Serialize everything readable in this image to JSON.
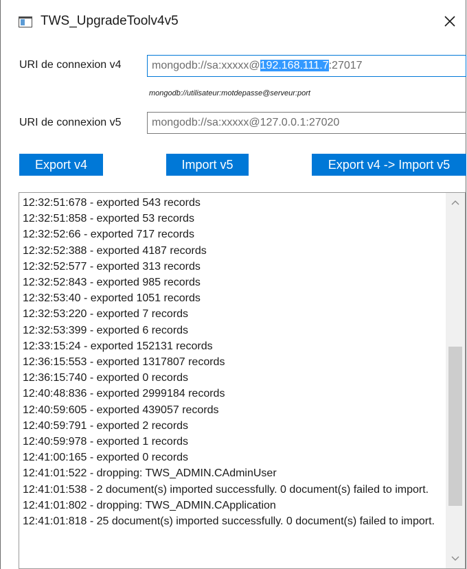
{
  "window": {
    "title": "TWS_UpgradeToolv4v5"
  },
  "form": {
    "v4_label": "URI de connexion v4",
    "v4_value_before": "mongodb://sa:xxxxx@",
    "v4_value_selected": "192.168.111.7",
    "v4_value_after": ":27017",
    "hint": "mongodb://utilisateur:motdepasse@serveur:port",
    "v5_label": "URI de connexion v5",
    "v5_value": "mongodb://sa:xxxxx@127.0.0.1:27020"
  },
  "buttons": {
    "export_v4": "Export v4",
    "import_v5": "Import v5",
    "export_import": "Export v4 -> Import v5"
  },
  "log": {
    "lines": [
      "12:32:51:678 - exported 543 records",
      "12:32:51:858 - exported 53 records",
      "12:32:52:66 - exported 717 records",
      "12:32:52:388 - exported 4187 records",
      "12:32:52:577 - exported 313 records",
      "12:32:52:843 - exported 985 records",
      "12:32:53:40 - exported 1051 records",
      "12:32:53:220 - exported 7 records",
      "12:32:53:399 - exported 6 records",
      "12:33:15:24 - exported 152131 records",
      "12:36:15:553 - exported 1317807 records",
      "12:36:15:740 - exported 0 records",
      "12:40:48:836 - exported 2999184 records",
      "12:40:59:605 - exported 439057 records",
      "12:40:59:791 - exported 2 records",
      "12:40:59:978 - exported 1 records",
      "12:41:00:165 - exported 0 records",
      "12:41:01:522 - dropping: TWS_ADMIN.CAdminUser",
      "12:41:01:538 - 2 document(s) imported successfully. 0 document(s) failed to import.",
      "12:41:01:802 - dropping: TWS_ADMIN.CApplication",
      "12:41:01:818 - 25 document(s) imported successfully. 0 document(s) failed to import."
    ]
  },
  "colors": {
    "accent": "#0078d7",
    "selection": "#3399ff"
  },
  "icons": {
    "app": "window-app-icon",
    "close": "close-icon",
    "scroll_up": "chevron-up-icon",
    "scroll_down": "chevron-down-icon"
  }
}
